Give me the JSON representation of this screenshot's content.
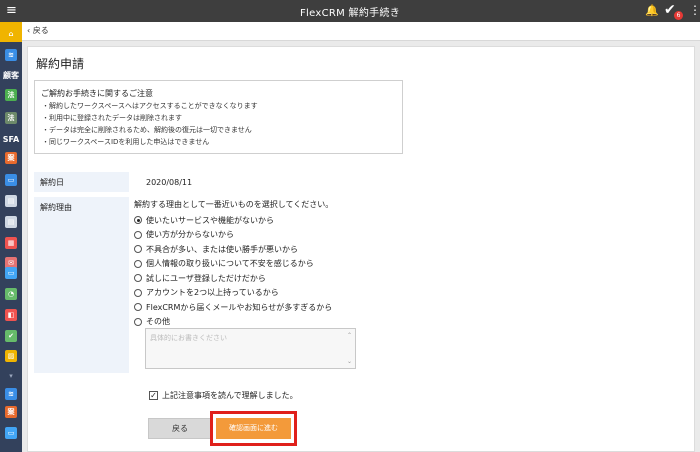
{
  "app": {
    "title": "FlexCRM 解約手続き",
    "menu_icon": "≡",
    "bell_icon": "🔔",
    "task_badge": "6",
    "task_badge_color": "#e53935",
    "kebab_icon": "⋮"
  },
  "sidebar": {
    "bg_color": "#33415c",
    "active_color": "#f0b400",
    "items": [
      {
        "name": "sidebar-home",
        "icon": "⌂",
        "color": "#f0b400"
      },
      {
        "name": "sidebar-database",
        "icon": "≋",
        "color": "#3a8ee6"
      },
      {
        "name": "sidebar-customer-label",
        "text": "顧客"
      },
      {
        "name": "sidebar-customer-corp",
        "text": "法",
        "color": "#4caf50"
      },
      {
        "name": "sidebar-customer-corp2",
        "text": "法",
        "color": "#6d8a6a"
      },
      {
        "name": "sidebar-sfa-label",
        "text": "SFA"
      },
      {
        "name": "sidebar-sfa-deal",
        "text": "案",
        "color": "#e86a2d"
      },
      {
        "name": "sidebar-chat",
        "icon": "▭",
        "color": "#3a8ee6"
      },
      {
        "name": "sidebar-doc",
        "icon": "▤",
        "color": "#cfd8e3"
      },
      {
        "name": "sidebar-doc2",
        "icon": "▤",
        "color": "#cfd8e3"
      },
      {
        "name": "sidebar-calendar",
        "icon": "▦",
        "color": "#ef5350"
      },
      {
        "name": "sidebar-mail",
        "icon": "✉",
        "color": "#e57373"
      },
      {
        "name": "sidebar-message",
        "icon": "▭",
        "color": "#42a5f5"
      },
      {
        "name": "sidebar-report",
        "icon": "◔",
        "color": "#66bb6a"
      },
      {
        "name": "sidebar-notes",
        "icon": "◧",
        "color": "#ef5350"
      },
      {
        "name": "sidebar-todo",
        "icon": "✔",
        "color": "#66bb6a"
      },
      {
        "name": "sidebar-gallery",
        "icon": "▨",
        "color": "#f0b400"
      },
      {
        "name": "sidebar-scroll",
        "icon": "▾",
        "color": "#33415c"
      },
      {
        "name": "sidebar-database2",
        "icon": "≋",
        "color": "#3a8ee6"
      },
      {
        "name": "sidebar-deal2",
        "text": "案",
        "color": "#e86a2d"
      },
      {
        "name": "sidebar-chat2",
        "icon": "▭",
        "color": "#42a5f5"
      }
    ]
  },
  "subbar": {
    "back_label": "戻る"
  },
  "page": {
    "title": "解約申請",
    "notice": {
      "heading": "ご解約お手続きに関するご注意",
      "lines": [
        "・解約したワークスペースへはアクセスすることができなくなります",
        "・利用中に登録されたデータは削除されます",
        "・データは完全に削除されるため、解約後の復元は一切できません",
        "・同じワークスペースIDを利用した申込はできません"
      ]
    },
    "cancel_date_label": "解約日",
    "cancel_date_value": "2020/08/11",
    "reason_label": "解約理由",
    "reason_prompt": "解約する理由として一番近いものを選択してください。",
    "reasons": [
      {
        "label": "使いたいサービスや機能がないから",
        "selected": true
      },
      {
        "label": "使い方が分からないから",
        "selected": false
      },
      {
        "label": "不具合が多い、または使い勝手が悪いから",
        "selected": false
      },
      {
        "label": "個人情報の取り扱いについて不安を感じるから",
        "selected": false
      },
      {
        "label": "試しにユーザ登録しただけだから",
        "selected": false
      },
      {
        "label": "アカウントを2つ以上持っているから",
        "selected": false
      },
      {
        "label": "FlexCRMから届くメールやお知らせが多すぎるから",
        "selected": false
      },
      {
        "label": "その他",
        "selected": false
      }
    ],
    "other_placeholder": "具体的にお書きください",
    "agree_label": "上記注意事項を読んで理解しました。",
    "agree_checked": true,
    "back_button": "戻る",
    "confirm_button": "確認画面に進む",
    "confirm_color": "#f39a3a",
    "highlight_color": "#e0201b"
  }
}
